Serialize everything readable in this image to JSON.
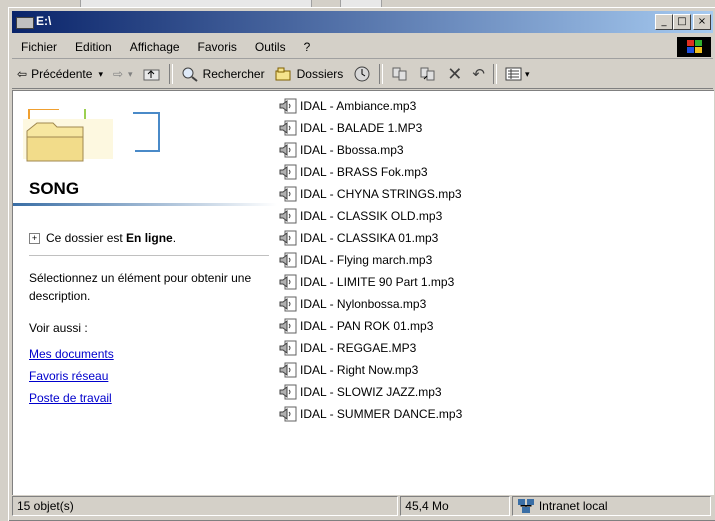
{
  "window": {
    "title": "E:\\"
  },
  "title_buttons": {
    "minimize": "_",
    "maximize": "□",
    "close": "×"
  },
  "menu": [
    "Fichier",
    "Edition",
    "Affichage",
    "Favoris",
    "Outils",
    "?"
  ],
  "toolbar": {
    "back_label": "Précédente",
    "search_label": "Rechercher",
    "folders_label": "Dossiers"
  },
  "left_pane": {
    "folder_name": "SONG",
    "online_text": "Ce dossier est",
    "online_bold": "En ligne",
    "online_end": ".",
    "description": "Sélectionnez un élément pour obtenir une description.",
    "see_also": "Voir aussi :",
    "links": [
      "Mes documents",
      "Favoris réseau",
      "Poste de travail"
    ]
  },
  "files": [
    "IDAL - Ambiance.mp3",
    "IDAL - BALADE 1.MP3",
    "IDAL - Bbossa.mp3",
    "IDAL - BRASS Fok.mp3",
    "IDAL - CHYNA STRINGS.mp3",
    "IDAL - CLASSIK OLD.mp3",
    "IDAL - CLASSIKA 01.mp3",
    "IDAL - Flying march.mp3",
    "IDAL - LIMITE 90 Part 1.mp3",
    "IDAL - Nylonbossa.mp3",
    "IDAL - PAN ROK 01.mp3",
    "IDAL - REGGAE.MP3",
    "IDAL - Right Now.mp3",
    "IDAL - SLOWIZ JAZZ.mp3",
    "IDAL - SUMMER DANCE.mp3"
  ],
  "status": {
    "count": "15 objet(s)",
    "size": "45,4 Mo",
    "zone": "Intranet local"
  },
  "colors": {
    "titlebar_start": "#0a246a",
    "titlebar_end": "#a6caf0",
    "link": "#0000cc",
    "face": "#d4d0c8"
  }
}
